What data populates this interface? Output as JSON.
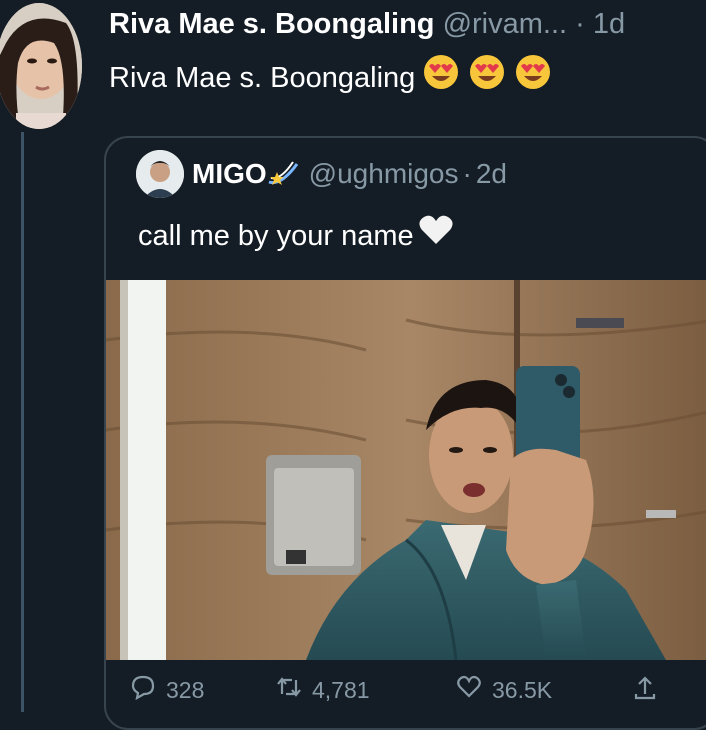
{
  "retweet": {
    "author_name": "Riva Mae s. Boongaling",
    "author_handle": "@rivam...",
    "time_sep": "·",
    "time": "1d",
    "text": "Riva Mae s. Boongaling",
    "emojis": [
      "heart-eyes-emoji",
      "heart-eyes-emoji",
      "heart-eyes-emoji"
    ]
  },
  "quoted": {
    "author_name": "MIGO",
    "author_handle": "@ughmigos",
    "time_sep": "·",
    "time": "2d",
    "text": "call me by your name",
    "text_emoji": "white-heart-emoji",
    "name_emoji": "shooting-star-emoji"
  },
  "actions": {
    "replies": "328",
    "retweets": "4,781",
    "likes": "36.5K"
  },
  "colors": {
    "background": "#141d26",
    "secondary_text": "#8899a6",
    "border": "#38444d"
  }
}
